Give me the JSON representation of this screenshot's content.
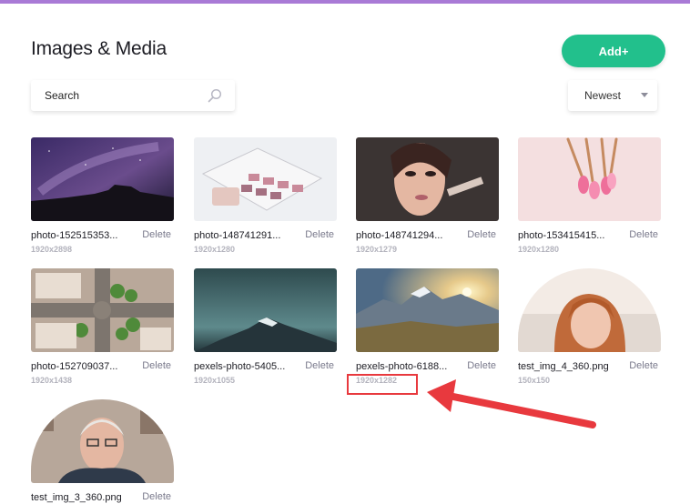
{
  "header": {
    "title": "Images & Media",
    "add_label": "Add+"
  },
  "search": {
    "placeholder": "Search"
  },
  "sort": {
    "selected": "Newest"
  },
  "accent_colors": {
    "top_bar": "#a97ad6",
    "add_button": "#22c08c",
    "highlight": "#e8393e"
  },
  "media": [
    {
      "name": "photo-152515353...",
      "dimensions": "1920x2898",
      "delete_label": "Delete"
    },
    {
      "name": "photo-148741291...",
      "dimensions": "1920x1280",
      "delete_label": "Delete"
    },
    {
      "name": "photo-148741294...",
      "dimensions": "1920x1279",
      "delete_label": "Delete"
    },
    {
      "name": "photo-153415415...",
      "dimensions": "1920x1280",
      "delete_label": "Delete"
    },
    {
      "name": "photo-152709037...",
      "dimensions": "1920x1438",
      "delete_label": "Delete"
    },
    {
      "name": "pexels-photo-5405...",
      "dimensions": "1920x1055",
      "delete_label": "Delete"
    },
    {
      "name": "pexels-photo-6188...",
      "dimensions": "1920x1282",
      "delete_label": "Delete"
    },
    {
      "name": "test_img_4_360.png",
      "dimensions": "150x150",
      "delete_label": "Delete"
    },
    {
      "name": "test_img_3_360.png",
      "dimensions": "",
      "delete_label": "Delete"
    }
  ]
}
